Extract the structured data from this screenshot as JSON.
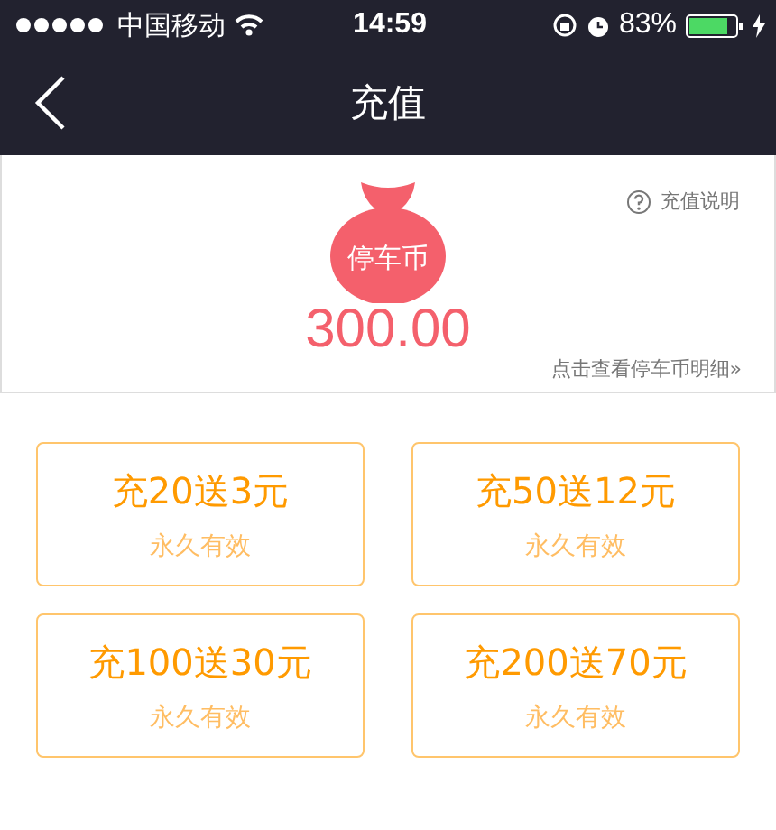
{
  "status_bar": {
    "carrier": "中国移动",
    "time": "14:59",
    "battery": "83%"
  },
  "nav": {
    "title": "充值"
  },
  "balance": {
    "help": "充值说明",
    "coin_label": "停车币",
    "amount": "300.00",
    "detail_link": "点击查看停车币明细",
    "detail_arrow": "»"
  },
  "packages": [
    {
      "title": "充20送3元",
      "note": "永久有效"
    },
    {
      "title": "充50送12元",
      "note": "永久有效"
    },
    {
      "title": "充100送30元",
      "note": "永久有效"
    },
    {
      "title": "充200送70元",
      "note": "永久有效"
    }
  ]
}
